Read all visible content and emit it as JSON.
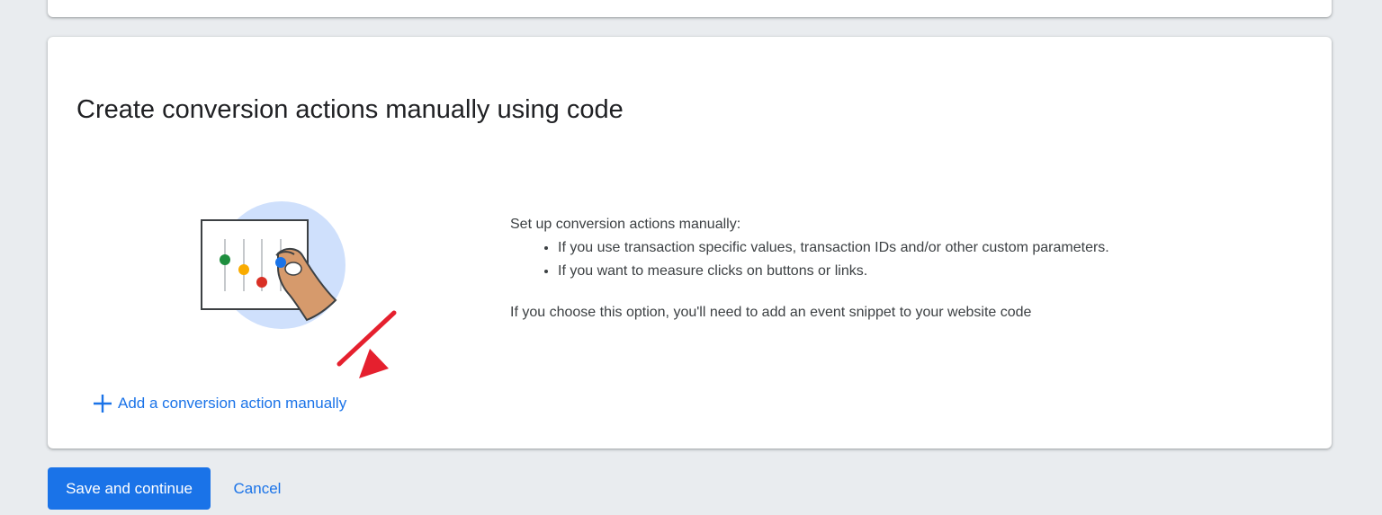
{
  "card": {
    "title": "Create conversion actions manually using code",
    "description": {
      "intro": "Set up conversion actions manually:",
      "bullets": [
        "If you use transaction specific values, transaction IDs and/or other custom parameters.",
        "If you want to measure clicks on buttons or links."
      ],
      "note": "If you choose this option, you'll need to add an event snippet to your website code"
    },
    "add_link": {
      "icon": "plus-icon",
      "label": "Add a conversion action manually"
    },
    "illustration": {
      "icon": "settings-sliders-hand-icon"
    }
  },
  "annotation": {
    "icon": "red-arrow-icon",
    "color": "#e5202e"
  },
  "footer": {
    "save_label": "Save and continue",
    "cancel_label": "Cancel"
  },
  "colors": {
    "accent": "#1a73e8",
    "background": "#e9ecef",
    "card": "#ffffff",
    "title_text": "#202124",
    "body_text": "#3c4043",
    "illustration_circle": "#cfe0fc",
    "slider_green": "#1e8e3e",
    "slider_yellow": "#f9ab00",
    "slider_red": "#d93025",
    "slider_blue": "#1a73e8",
    "skin": "#d69a6c"
  }
}
